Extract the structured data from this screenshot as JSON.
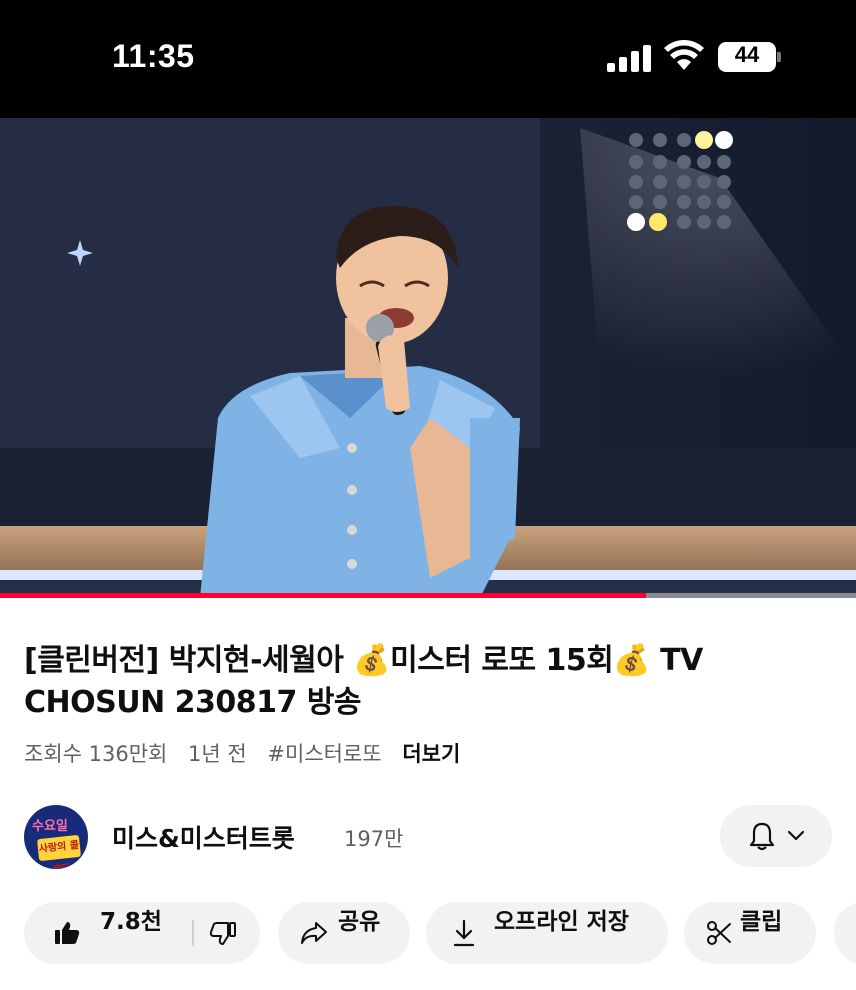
{
  "status_bar": {
    "time": "11:35",
    "battery": "44",
    "icons": [
      "cellular-signal-icon",
      "wifi-icon",
      "battery-icon"
    ]
  },
  "video": {
    "playback_progress": 0.755
  },
  "title": "[클린버전] 박지현-세월아 💰미스터 로또 15회💰 TV CHOSUN 230817 방송",
  "meta": {
    "views": "조회수 136만회",
    "age": "1년 전",
    "hashtag": "#미스터로또",
    "more": "더보기"
  },
  "channel": {
    "name": "미스&미스터트롯",
    "subscribers": "197만",
    "avatar_top_text": "수요일",
    "avatar_bar_text": "사랑의 콜센타"
  },
  "actions": {
    "like_count": "7.8천",
    "share": "공유",
    "download": "오프라인 저장",
    "clip": "클립"
  },
  "colors": {
    "accent": "#ff0033",
    "pill_bg": "#f2f2f2",
    "secondary_text": "#606060"
  }
}
